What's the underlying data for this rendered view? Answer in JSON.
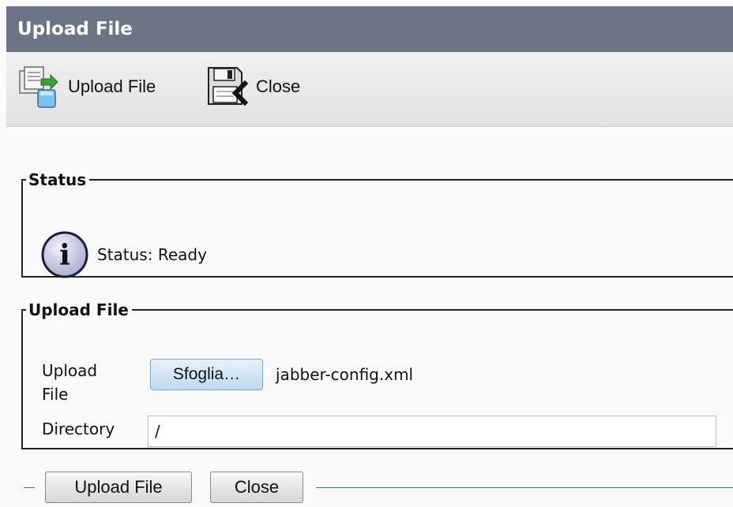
{
  "window": {
    "title": "Upload File"
  },
  "toolbar": {
    "upload_label": "Upload File",
    "upload_icon": "upload-file-icon",
    "close_label": "Close",
    "close_icon": "floppy-close-icon"
  },
  "status": {
    "legend": "Status",
    "icon": "info-icon",
    "text": "Status: Ready"
  },
  "upload": {
    "legend": "Upload File",
    "file_label": "Upload\nFile",
    "browse_label": "Sfoglia…",
    "file_name": "jabber-config.xml",
    "directory_label": "Directory",
    "directory_value": "/"
  },
  "footer": {
    "upload_label": "Upload File",
    "close_label": "Close"
  },
  "colors": {
    "title_bar": "#6c7585",
    "browse_button": "#bfdaf0",
    "divider": "#3a7a76"
  }
}
